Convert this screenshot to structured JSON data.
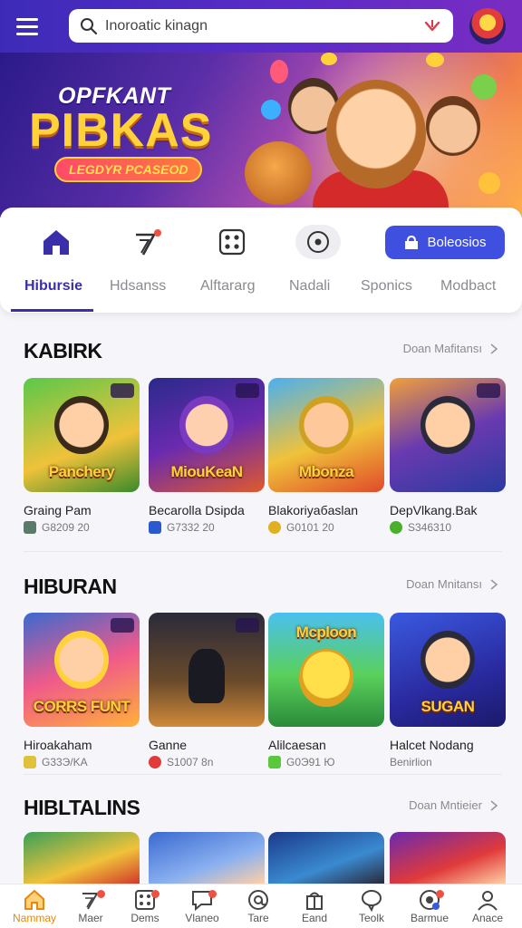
{
  "header": {
    "menu_icon": "hamburger-menu-icon",
    "search_placeholder": "Inoroatic kinagn",
    "search_icon": "search-icon",
    "dropdown_icon": "chevron-down-icon"
  },
  "banner": {
    "title_line1": "OPFKANT",
    "title_line2": "PIBKAS",
    "pill": "LEGDYR PCASEOD"
  },
  "toolbar": {
    "icons": [
      "home-icon",
      "slash-seven-icon",
      "dice-icon",
      "target-icon"
    ],
    "cta_label": "Boleosios",
    "cta_icon": "bag-icon"
  },
  "tabs": [
    "Hibursie",
    "Hdsanss",
    "Alftararg",
    "Nadali",
    "Sponics",
    "Modbact"
  ],
  "sections": [
    {
      "title": "KABIRK",
      "more": "Doan Mafitansı",
      "cards": [
        {
          "name": "Graing Pam",
          "meta": "G8209 20",
          "thumb_label": "Panchery"
        },
        {
          "name": "Becarolla Dsipda",
          "meta": "G7332 20",
          "thumb_label": "MiouKeaN"
        },
        {
          "name": "Blakoriyaбaslan",
          "meta": "G0101 20",
          "thumb_label": "Mbonza"
        },
        {
          "name": "DepVlkang.Bak",
          "meta": "S346310",
          "thumb_label": ""
        }
      ]
    },
    {
      "title": "HIBURAN",
      "more": "Doan Mnitansı",
      "cards": [
        {
          "name": "Hiroakaham",
          "meta": "G33Э/KA",
          "thumb_label": "CORRS FUNT"
        },
        {
          "name": "Ganne",
          "meta": "S1007 8n",
          "thumb_label": ""
        },
        {
          "name": "Alilcaesan",
          "meta": "G0Э91 Ю",
          "thumb_label": "Mcploon"
        },
        {
          "name": "Halcet Nodang",
          "meta": "Benirlion",
          "thumb_label": "SUGAN"
        }
      ]
    },
    {
      "title": "HIBLTALINS",
      "more": "Doan Mntieier",
      "cards": []
    }
  ],
  "thumb_tags": [
    "ZD",
    "m",
    "ID",
    "ZU"
  ],
  "bottom_nav": [
    {
      "label": "Nammay",
      "icon": "home-icon",
      "active": true
    },
    {
      "label": "Maer",
      "icon": "slash-seven-icon",
      "badge": true
    },
    {
      "label": "Dems",
      "icon": "dice-icon",
      "badge": true
    },
    {
      "label": "Vlaneo",
      "icon": "chat-icon",
      "badge": true
    },
    {
      "label": "Tare",
      "icon": "at-sign-icon"
    },
    {
      "label": "Eand",
      "icon": "gift-icon"
    },
    {
      "label": "Teolk",
      "icon": "speech-bubble-icon"
    },
    {
      "label": "Barmue",
      "icon": "target-icon",
      "badge": true
    },
    {
      "label": "Anace",
      "icon": "user-icon"
    }
  ],
  "colors": {
    "brand": "#3a2fa8",
    "cta": "#3f4fe0",
    "nav_active": "#e58a10"
  }
}
